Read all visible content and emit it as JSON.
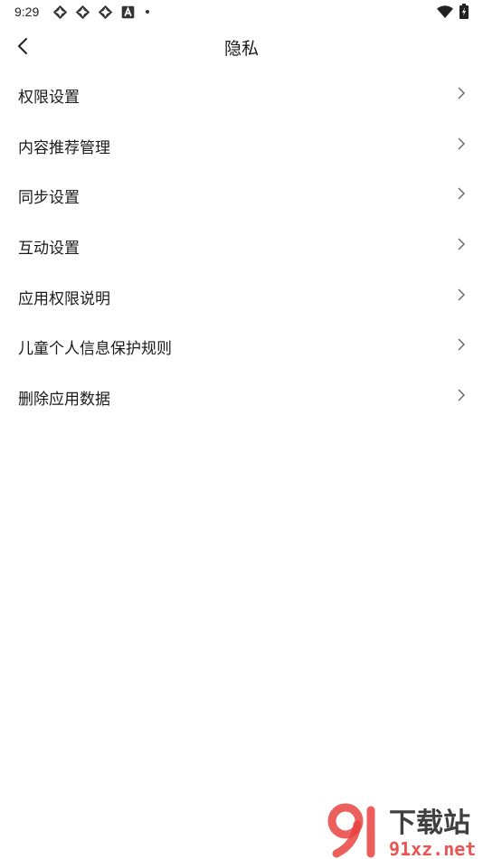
{
  "status_bar": {
    "time": "9:29",
    "notification_icons": [
      "app-notification-icon",
      "app-notification-icon",
      "app-notification-icon",
      "a-notification-icon"
    ],
    "wifi_icon": "wifi-icon",
    "battery_icon": "battery-charging-icon"
  },
  "header": {
    "back_icon": "chevron-left-icon",
    "title": "隐私"
  },
  "menu": {
    "items": [
      {
        "label": "权限设置"
      },
      {
        "label": "内容推荐管理"
      },
      {
        "label": "同步设置"
      },
      {
        "label": "互动设置"
      },
      {
        "label": "应用权限说明"
      },
      {
        "label": "儿童个人信息保护规则"
      },
      {
        "label": "删除应用数据"
      }
    ],
    "chevron_icon": "chevron-right-icon"
  },
  "watermark": {
    "brand_top": "下载站",
    "brand_bottom": "91xz.net",
    "colors": {
      "red": "#e8433f",
      "dark": "#2b2b2b"
    }
  }
}
